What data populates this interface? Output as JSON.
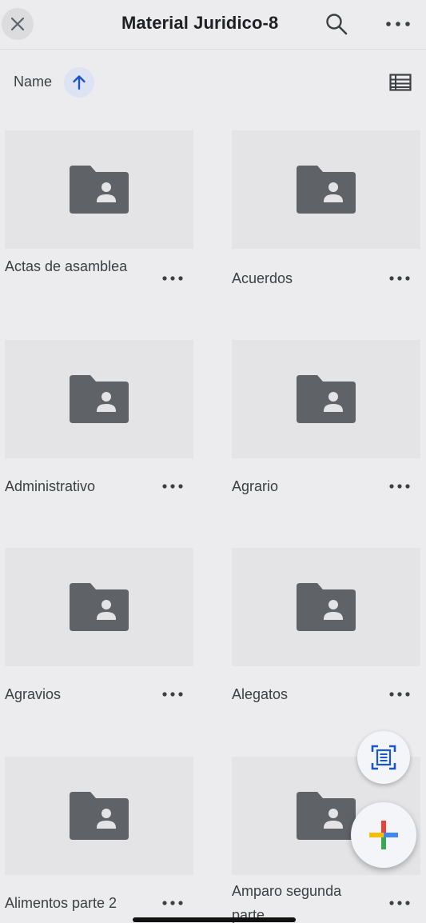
{
  "header": {
    "title": "Material Juridico-8",
    "close_icon": "close-icon",
    "search_icon": "search-icon",
    "more_icon": "more-horizontal-icon"
  },
  "sort": {
    "label": "Name",
    "direction_icon": "arrow-up-icon",
    "view_icon": "list-view-icon"
  },
  "folders": [
    {
      "name": "Actas de asamblea"
    },
    {
      "name": "Acuerdos"
    },
    {
      "name": "Administrativo"
    },
    {
      "name": "Agrario"
    },
    {
      "name": "Agravios"
    },
    {
      "name": "Alegatos"
    },
    {
      "name": "Alimentos parte 2"
    },
    {
      "name": "Amparo segunda parte"
    }
  ],
  "fabs": {
    "scan_icon": "scan-document-icon",
    "new_icon": "plus-icon"
  },
  "colors": {
    "background": "#ececef",
    "folder_icon": "#5f6368",
    "sort_accent": "#1a56c9",
    "plus_blue": "#4285f4",
    "plus_red": "#ea4335",
    "plus_yellow": "#fbbc04",
    "plus_green": "#34a853"
  }
}
